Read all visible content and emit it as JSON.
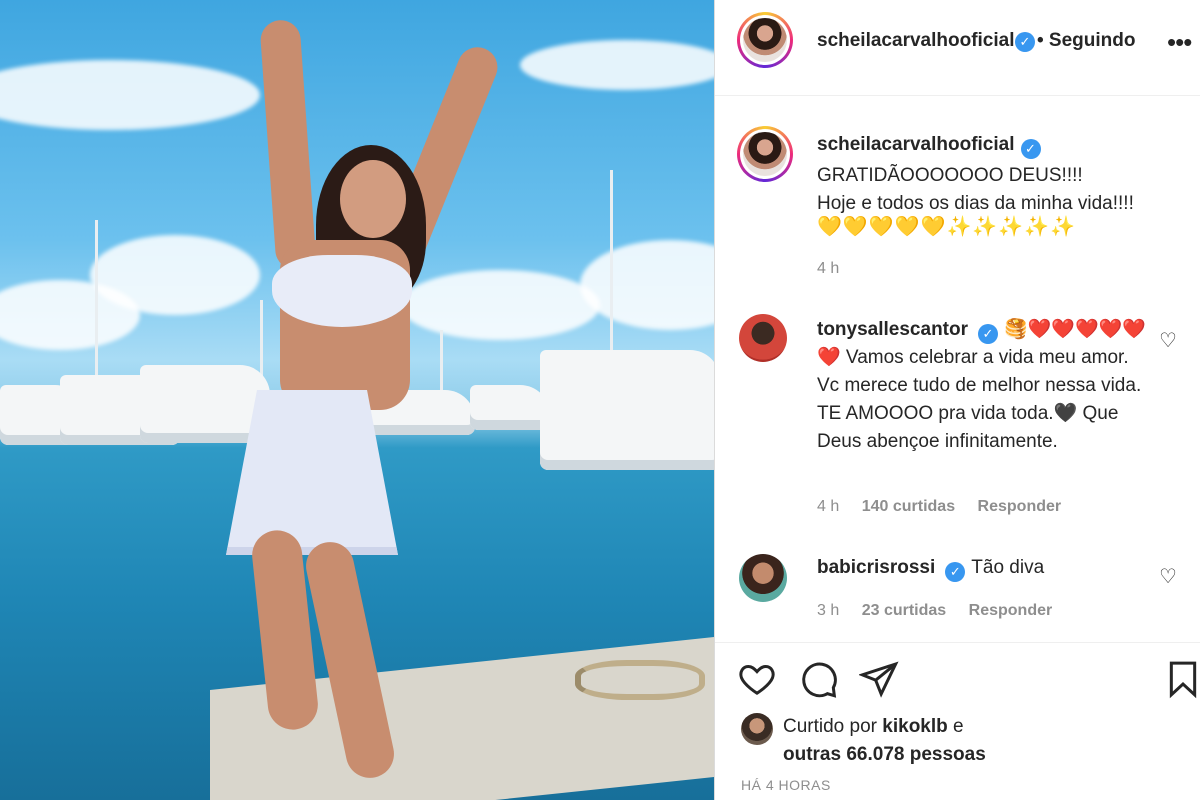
{
  "header": {
    "username": "scheilacarvalhooficial",
    "following_label": "• Seguindo",
    "more_icon": "more-horizontal-icon"
  },
  "caption": {
    "username": "scheilacarvalhooficial",
    "text": "GRATIDÃOOOOOOO DEUS!!!!\nHoje e todos os dias da minha vida!!!!",
    "emojis": "💛💛💛💛💛✨✨✨✨✨",
    "time": "4 h"
  },
  "comments": [
    {
      "username": "tonysallescantor",
      "text": "🥞❤️❤️❤️❤️❤️❤️ Vamos celebrar a vida meu amor. Vc merece tudo de melhor nessa vida. TE AMOOOO pra vida toda.🖤 Que Deus abençoe infinitamente.",
      "time": "4 h",
      "likes": "140 curtidas",
      "reply_label": "Responder"
    },
    {
      "username": "babicrisrossi",
      "text": "Tão diva",
      "time": "3 h",
      "likes": "23 curtidas",
      "reply_label": "Responder"
    }
  ],
  "likes": {
    "prefix": "Curtido por",
    "user": "kikoklb",
    "conjunction": "e",
    "others": "outras 66.078 pessoas"
  },
  "post_time": "HÁ 4 HORAS",
  "colors": {
    "verified": "#3897f0",
    "meta_text": "#8e8e8e",
    "primary_text": "#262626"
  }
}
